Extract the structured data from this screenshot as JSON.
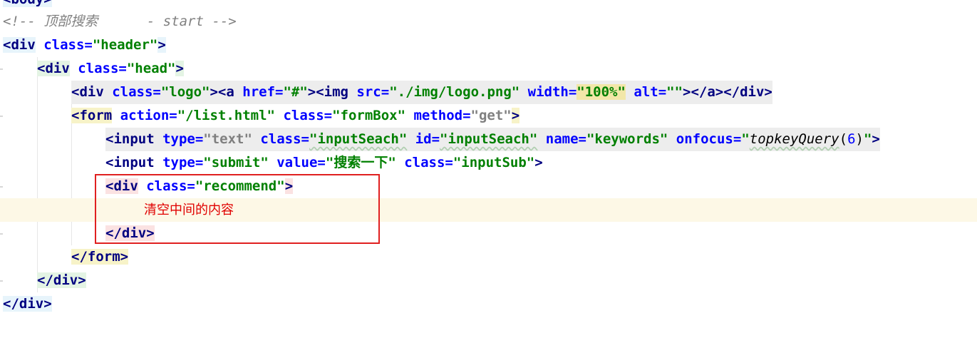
{
  "lines": {
    "l0": {
      "text": "<body>"
    },
    "l1": {
      "open": "<!--",
      "text": " 顶部搜索 ",
      "mid": "     - start ",
      "close": "-->"
    },
    "l2": {
      "t1": "<div",
      "a1": " class=",
      "v1": "\"header\"",
      "t2": ">"
    },
    "l3": {
      "t1": "<div",
      "a1": " class=",
      "v1": "\"head\"",
      "t2": ">"
    },
    "l4": {
      "t1": "<div",
      "a1": " class=",
      "v1": "\"logo\"",
      "t2": "><a",
      "a2": " href=",
      "v2": "\"#\"",
      "t3": "><img",
      "a3": " src=",
      "v3": "\"./img/logo.png\"",
      "a4": " width=",
      "v4": "\"100%\"",
      "a5": " alt=",
      "v5": "\"\"",
      "t4": "></a></div>"
    },
    "l5": {
      "t1": "<form",
      "a1": " action=",
      "v1": "\"/list.html\"",
      "a2": " class=",
      "v2": "\"formBox\"",
      "a3": " method=",
      "v3": "\"get\"",
      "t2": ">"
    },
    "l6": {
      "t1": "<input",
      "a1": " type=",
      "v1": "\"text\"",
      "a2": " class=",
      "v2": "\"inputSeach\"",
      "a3": " id=",
      "v3": "\"inputSeach\"",
      "a4": " name=",
      "v4": "\"keywords\"",
      "a5": " onfocus=",
      "q1": "\"",
      "fn": "topkeyQuery",
      "p1": "(",
      "num": "6",
      "p2": ")",
      "q2": "\"",
      "t2": ">"
    },
    "l7": {
      "t1": "<input",
      "a1": " type=",
      "v1": "\"submit\"",
      "a2": " value=",
      "v2": "\"搜索一下\"",
      "a3": " class=",
      "v3": "\"inputSub\"",
      "t2": ">"
    },
    "l8": {
      "t1": "<div",
      "a1": " class=",
      "v1": "\"recommend\"",
      "t2": ">"
    },
    "l9": {
      "note": "清空中间的内容"
    },
    "l10": {
      "t1": "</div>"
    },
    "l11": {
      "t1": "</form>"
    },
    "l12": {
      "t1": "</div>"
    },
    "l13": {
      "t1": "</div>"
    }
  },
  "colors": {
    "annotation_box": "#e02020",
    "current_line": "#fdf8e6",
    "tag": "#000080",
    "attribute": "#0000ff",
    "value": "#008000",
    "comment": "#808080"
  }
}
